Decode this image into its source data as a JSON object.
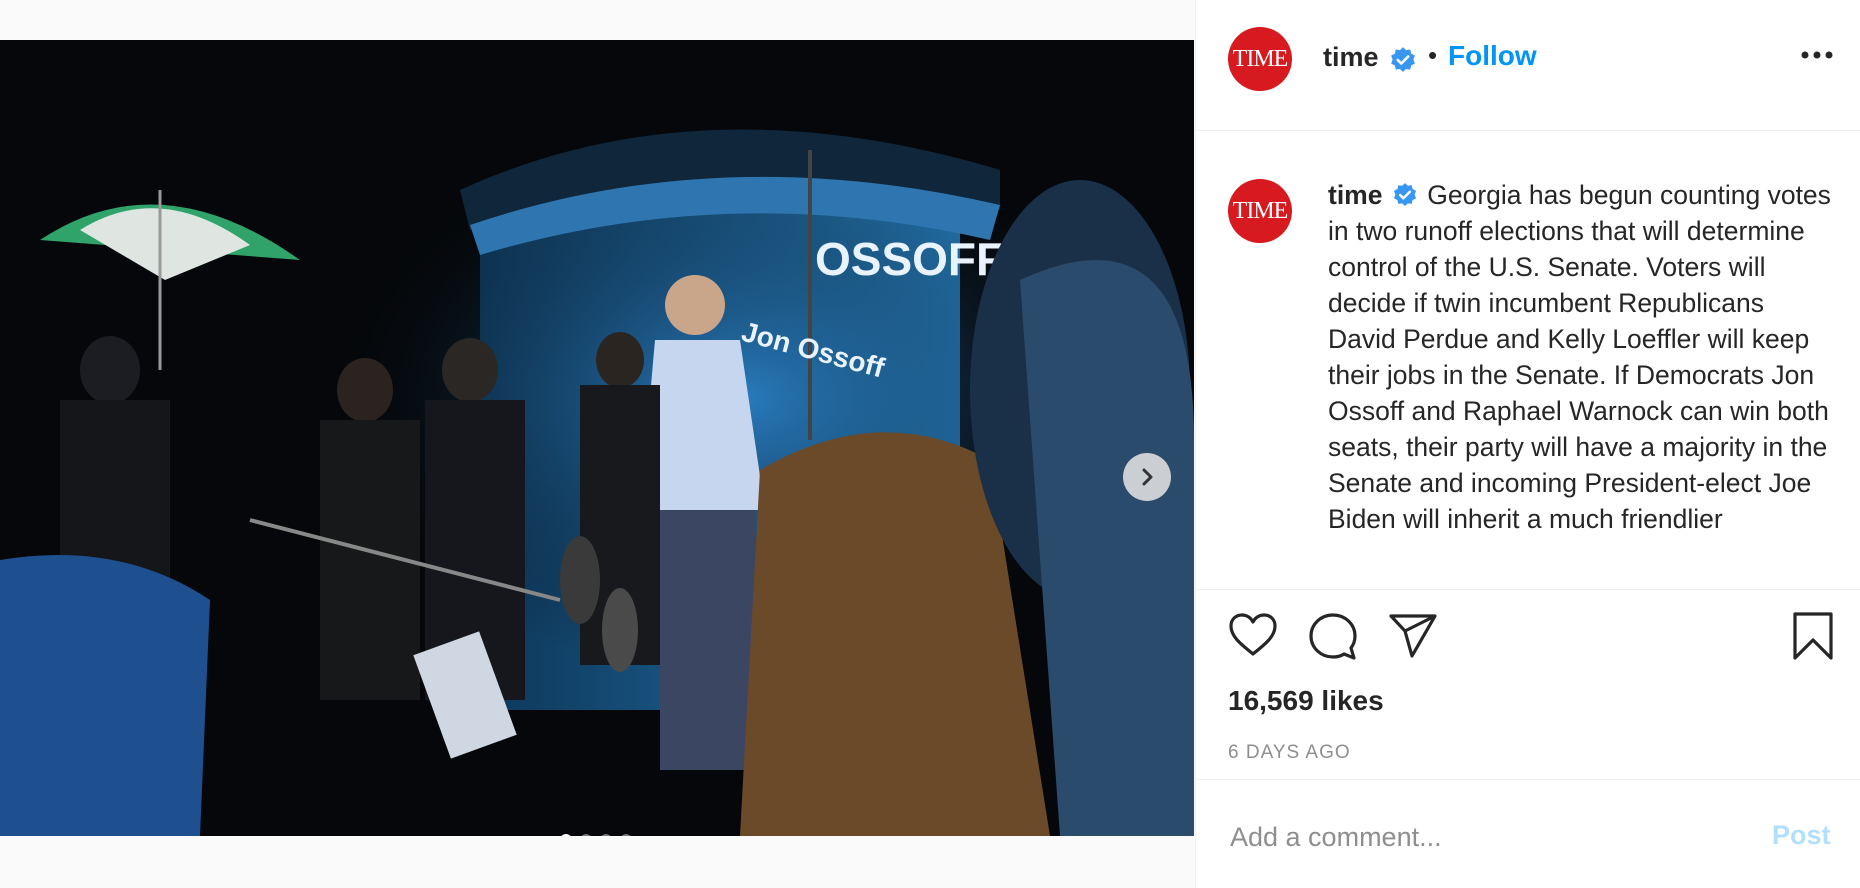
{
  "post": {
    "username": "time",
    "avatar_text": "TIME",
    "verified_icon": "verified-badge-icon",
    "separator": "•",
    "follow_label": "Follow",
    "caption": "Georgia has begun counting votes in two runoff elections that will determine control of the U.S. Senate. Voters will decide if twin incumbent Republicans David Perdue and Kelly Loeffler will keep their jobs in the Senate. If Democrats Jon Ossoff and Raphael Warnock can win both seats, their party will have a majority in the Senate and incoming President-elect Joe Biden will inherit a much friendlier",
    "likes": "16,569 likes",
    "time_ago": "6 DAYS AGO",
    "carousel": {
      "slide_count": 4,
      "active_index": 0
    },
    "photo_sign_text": "Jon Ossoff",
    "photo_banner_text": "OSSOFF"
  },
  "comment": {
    "placeholder": "Add a comment...",
    "post_label": "Post"
  },
  "colors": {
    "accent": "#0095f6",
    "post_disabled": "#b2dffc",
    "avatar_bg": "#d71920",
    "verified": "#3897f0"
  },
  "icons": [
    "heart-icon",
    "comment-icon",
    "share-icon",
    "bookmark-icon",
    "more-options-icon",
    "chevron-right-icon"
  ]
}
